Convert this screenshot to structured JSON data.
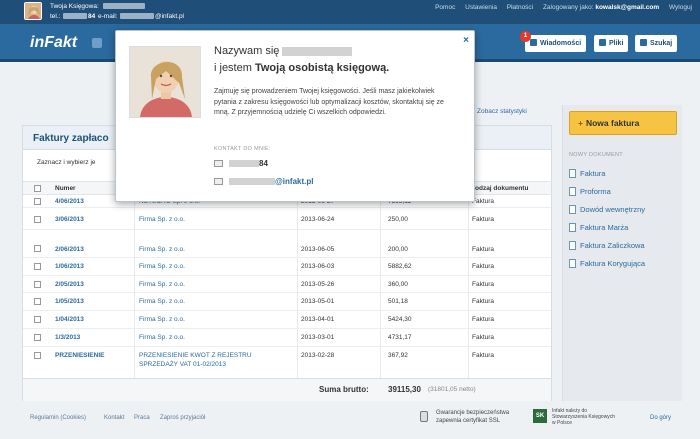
{
  "topbar": {
    "accountant_label": "Twoja Księgowa:",
    "tel_label": "tel.:",
    "tel_suffix": "84",
    "email_label": "e-mail:",
    "email_domain": "@infakt.pl",
    "links": [
      "Pomoc",
      "Ustawienia",
      "Płatności"
    ],
    "logged_in_label": "Zalogowany jako:",
    "user": "kowalsk@gmail.com",
    "logout": "Wyloguj"
  },
  "nav": {
    "logo": "inFakt",
    "badge_count": "1",
    "messages": "Wiadomości",
    "files": "Pliki",
    "search": "Szukaj"
  },
  "stats_link": "Zobacz statystyki",
  "invoices": {
    "title": "Faktury zapłaco",
    "subbar": "Zaznacz i wybierz je",
    "columns": {
      "number": "Numer",
      "doc_type": "odzaj dokumentu"
    },
    "rows": [
      {
        "number": "4/06/2013",
        "client": "NETSCRO Sp. z o.o.",
        "date": "2013-06-27",
        "amount": "7398,11",
        "type": "Faktura"
      },
      {
        "number": "3/06/2013",
        "client": "Firma Sp. z o.o.",
        "date": "2013-06-24",
        "amount": "250,00",
        "type": "Faktura"
      },
      {
        "number": "2/06/2013",
        "client": "Firma Sp. z o.o.",
        "date": "2013-06-05",
        "amount": "200,00",
        "type": "Faktura"
      },
      {
        "number": "1/06/2013",
        "client": "Firma Sp. z o.o.",
        "date": "2013-06-03",
        "amount": "5882,62",
        "type": "Faktura"
      },
      {
        "number": "2/05/2013",
        "client": "Firma Sp. z o.o.",
        "date": "2013-05-26",
        "amount": "360,00",
        "type": "Faktura"
      },
      {
        "number": "1/05/2013",
        "client": "Firma Sp. z o.o.",
        "date": "2013-05-01",
        "amount": "501,18",
        "type": "Faktura"
      },
      {
        "number": "1/04/2013",
        "client": "Firma Sp. z o.o.",
        "date": "2013-04-01",
        "amount": "5424,30",
        "type": "Faktura"
      },
      {
        "number": "1/3/2013",
        "client": "Firma Sp. z o.o.",
        "date": "2013-03-01",
        "amount": "4731,17",
        "type": "Faktura"
      }
    ],
    "last_row": {
      "number": "PRZENIESIENIE",
      "client_line1": "PRZENIESIENIE KWOT Z REJESTRU",
      "client_line2": "SPRZEDAŻY VAT 01-02/2013",
      "date": "2013-02-28",
      "amount": "367,92",
      "type": "Faktura"
    },
    "sum_label": "Suma brutto:",
    "sum_value": "39115,30",
    "sum_netto": "(31801,05 netto)"
  },
  "sidebar": {
    "new_invoice": "Nowa faktura",
    "header": "NOWY DOKUMENT",
    "items": [
      "Faktura",
      "Proforma",
      "Dowód wewnętrzny",
      "Faktura Marża",
      "Faktura Zaliczkowa",
      "Faktura Korygująca"
    ]
  },
  "footer": {
    "links": [
      "Regulamin (Cookies)",
      "Kontakt",
      "Praca",
      "Zaproś przyjaciół"
    ],
    "ssl_line1": "Gwarancje bezpieczeństwa",
    "ssl_line2": "zapewnia certyfikat SSL",
    "skk_line1": "Infakt należy do",
    "skk_line2": "Stowarzyszenia Księgowych",
    "skk_line3": "w Polsce",
    "top": "Do góry"
  },
  "popup": {
    "heading_prefix": "Nazywam się",
    "heading2_prefix": "i jestem",
    "heading2_bold": "Twoją osobistą księgową.",
    "body": "Zajmuję się prowadzeniem Twojej księgowości. Jeśli masz jakiekolwiek pytania z zakresu księgowości lub optymalizacji kosztów, skontaktuj się ze mną. Z przyjemnością udzielę Ci wszelkich odpowiedzi.",
    "contact_header": "KONTAKT DO MNIE:",
    "phone_suffix": "84",
    "email_domain": "@infakt.pl",
    "close": "×"
  },
  "colors": {
    "topbar": "#1f4f78",
    "navbar": "#2b6a9e",
    "link": "#2b6a9e",
    "new_button": "#f6c343",
    "badge": "#e03a2a"
  }
}
